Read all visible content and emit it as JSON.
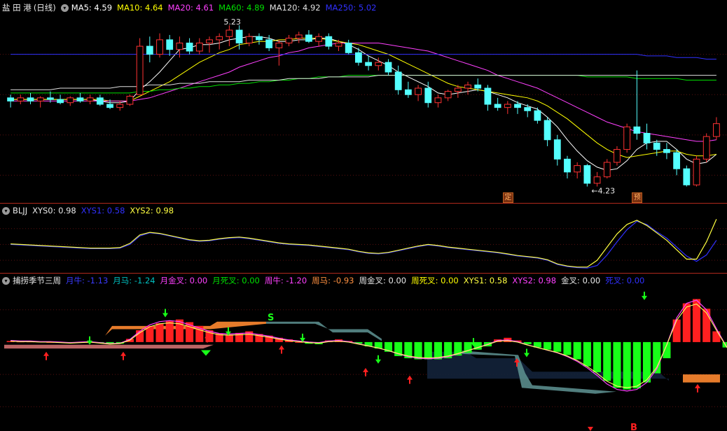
{
  "main": {
    "stock_name": "盐 田 港",
    "period": "(日线)",
    "ma": [
      {
        "label": "MA5",
        "value": "4.59",
        "color": "#ffffff"
      },
      {
        "label": "MA10",
        "value": "4.64",
        "color": "#ffff00"
      },
      {
        "label": "MA20",
        "value": "4.61",
        "color": "#ff40ff"
      },
      {
        "label": "MA60",
        "value": "4.89",
        "color": "#00e000"
      },
      {
        "label": "MA120",
        "value": "4.92",
        "color": "#e0e0e0"
      },
      {
        "label": "MA250",
        "value": "5.02",
        "color": "#3030ff"
      }
    ],
    "high_label": "5.23",
    "low_label": "4.23",
    "markers": [
      "定",
      "预"
    ],
    "colors": {
      "up": "#ff3232",
      "down": "#54ffff"
    }
  },
  "osc": {
    "name": "BLJJ",
    "items": [
      {
        "label": "XYS0",
        "value": "0.98",
        "color": "#e8e8e8"
      },
      {
        "label": "XYS1",
        "value": "0.58",
        "color": "#3030ff"
      },
      {
        "label": "XYS2",
        "value": "0.98",
        "color": "#ffff40"
      }
    ]
  },
  "ind": {
    "name": "捕捞季节三周",
    "items": [
      {
        "label": "月牛",
        "value": "-1.13",
        "color": "#3a3aff"
      },
      {
        "label": "月马",
        "value": "-1.24",
        "color": "#00c0c0"
      },
      {
        "label": "月金叉",
        "value": "0.00",
        "color": "#ff40ff"
      },
      {
        "label": "月死叉",
        "value": "0.00",
        "color": "#00e000"
      },
      {
        "label": "周牛",
        "value": "-1.20",
        "color": "#ff40ff"
      },
      {
        "label": "周马",
        "value": "-0.93",
        "color": "#ff9040"
      },
      {
        "label": "周金叉",
        "value": "0.00",
        "color": "#e8e8e8"
      },
      {
        "label": "周死叉",
        "value": "0.00",
        "color": "#ffff00"
      },
      {
        "label": "XYS1",
        "value": "0.58",
        "color": "#ffff40"
      },
      {
        "label": "XYS2",
        "value": "0.98",
        "color": "#ff40ff"
      },
      {
        "label": "金叉",
        "value": "0.00",
        "color": "#e8e8e8"
      },
      {
        "label": "死叉",
        "value": "0.00",
        "color": "#3030ff"
      }
    ],
    "s_label": "S",
    "b_label": "B"
  },
  "chart_data": {
    "type": "candlestick",
    "candles": [
      [
        4.78,
        4.8,
        4.72,
        4.76
      ],
      [
        4.76,
        4.8,
        4.74,
        4.78
      ],
      [
        4.78,
        4.81,
        4.74,
        4.76
      ],
      [
        4.76,
        4.79,
        4.72,
        4.78
      ],
      [
        4.78,
        4.82,
        4.75,
        4.77
      ],
      [
        4.77,
        4.8,
        4.74,
        4.75
      ],
      [
        4.75,
        4.79,
        4.73,
        4.78
      ],
      [
        4.78,
        4.81,
        4.75,
        4.76
      ],
      [
        4.76,
        4.8,
        4.74,
        4.78
      ],
      [
        4.78,
        4.8,
        4.73,
        4.74
      ],
      [
        4.74,
        4.77,
        4.71,
        4.72
      ],
      [
        4.72,
        4.76,
        4.7,
        4.74
      ],
      [
        4.74,
        4.8,
        4.73,
        4.79
      ],
      [
        4.8,
        5.15,
        4.8,
        5.1
      ],
      [
        5.1,
        5.16,
        5.0,
        5.05
      ],
      [
        5.05,
        5.18,
        5.03,
        5.14
      ],
      [
        5.14,
        5.17,
        5.04,
        5.08
      ],
      [
        5.08,
        5.16,
        5.03,
        5.12
      ],
      [
        5.12,
        5.15,
        5.05,
        5.07
      ],
      [
        5.07,
        5.15,
        5.05,
        5.12
      ],
      [
        5.12,
        5.16,
        5.06,
        5.14
      ],
      [
        5.14,
        5.18,
        5.08,
        5.16
      ],
      [
        5.16,
        5.23,
        5.1,
        5.2
      ],
      [
        5.2,
        5.23,
        5.08,
        5.12
      ],
      [
        5.12,
        5.18,
        5.1,
        5.16
      ],
      [
        5.16,
        5.18,
        5.11,
        5.14
      ],
      [
        5.14,
        5.17,
        5.07,
        5.09
      ],
      [
        5.09,
        5.14,
        4.98,
        5.12
      ],
      [
        5.12,
        5.17,
        5.1,
        5.15
      ],
      [
        5.15,
        5.19,
        5.12,
        5.17
      ],
      [
        5.17,
        5.2,
        5.12,
        5.13
      ],
      [
        5.13,
        5.18,
        5.1,
        5.16
      ],
      [
        5.16,
        5.18,
        5.08,
        5.1
      ],
      [
        5.1,
        5.14,
        5.07,
        5.12
      ],
      [
        5.12,
        5.14,
        5.05,
        5.06
      ],
      [
        5.06,
        5.09,
        4.98,
        5.0
      ],
      [
        5.0,
        5.04,
        4.95,
        4.98
      ],
      [
        4.98,
        5.03,
        4.95,
        5.0
      ],
      [
        5.0,
        5.02,
        4.92,
        4.94
      ],
      [
        4.94,
        4.98,
        4.8,
        4.83
      ],
      [
        4.83,
        4.88,
        4.78,
        4.8
      ],
      [
        4.8,
        4.86,
        4.76,
        4.84
      ],
      [
        4.84,
        4.88,
        4.72,
        4.75
      ],
      [
        4.75,
        4.8,
        4.72,
        4.78
      ],
      [
        4.78,
        4.83,
        4.76,
        4.82
      ],
      [
        4.82,
        4.86,
        4.78,
        4.84
      ],
      [
        4.84,
        4.88,
        4.8,
        4.86
      ],
      [
        4.86,
        4.9,
        4.82,
        4.84
      ],
      [
        4.84,
        4.86,
        4.7,
        4.74
      ],
      [
        4.74,
        4.78,
        4.7,
        4.72
      ],
      [
        4.72,
        4.76,
        4.68,
        4.74
      ],
      [
        4.74,
        4.76,
        4.68,
        4.72
      ],
      [
        4.72,
        4.74,
        4.66,
        4.7
      ],
      [
        4.7,
        4.72,
        4.62,
        4.64
      ],
      [
        4.64,
        4.66,
        4.48,
        4.52
      ],
      [
        4.52,
        4.55,
        4.36,
        4.4
      ],
      [
        4.4,
        4.42,
        4.28,
        4.32
      ],
      [
        4.32,
        4.38,
        4.28,
        4.36
      ],
      [
        4.36,
        4.37,
        4.23,
        4.25
      ],
      [
        4.25,
        4.32,
        4.23,
        4.29
      ],
      [
        4.29,
        4.4,
        4.28,
        4.38
      ],
      [
        4.38,
        4.48,
        4.36,
        4.46
      ],
      [
        4.46,
        4.62,
        4.44,
        4.6
      ],
      [
        4.6,
        4.95,
        4.52,
        4.56
      ],
      [
        4.56,
        4.62,
        4.46,
        4.5
      ],
      [
        4.5,
        4.52,
        4.42,
        4.46
      ],
      [
        4.46,
        4.5,
        4.4,
        4.44
      ],
      [
        4.44,
        4.46,
        4.3,
        4.34
      ],
      [
        4.34,
        4.36,
        4.23,
        4.24
      ],
      [
        4.24,
        4.42,
        4.23,
        4.4
      ],
      [
        4.4,
        4.56,
        4.38,
        4.54
      ],
      [
        4.54,
        4.66,
        4.52,
        4.62
      ]
    ],
    "ylim": [
      4.15,
      5.3
    ],
    "ma_series": {
      "MA5": [
        4.77,
        4.77,
        4.77,
        4.77,
        4.77,
        4.77,
        4.77,
        4.77,
        4.77,
        4.76,
        4.75,
        4.75,
        4.76,
        4.83,
        4.88,
        4.94,
        5.01,
        5.08,
        5.09,
        5.11,
        5.11,
        5.12,
        5.14,
        5.15,
        5.16,
        5.16,
        5.15,
        5.13,
        5.13,
        5.14,
        5.14,
        5.15,
        5.15,
        5.13,
        5.11,
        5.08,
        5.04,
        5.01,
        4.98,
        4.94,
        4.91,
        4.88,
        4.85,
        4.81,
        4.8,
        4.81,
        4.82,
        4.83,
        4.82,
        4.8,
        4.78,
        4.75,
        4.73,
        4.71,
        4.66,
        4.6,
        4.52,
        4.45,
        4.39,
        4.35,
        4.33,
        4.34,
        4.39,
        4.46,
        4.5,
        4.51,
        4.51,
        4.46,
        4.4,
        4.37,
        4.38,
        4.43
      ],
      "MA10": [
        4.77,
        4.77,
        4.77,
        4.77,
        4.77,
        4.77,
        4.77,
        4.77,
        4.77,
        4.77,
        4.76,
        4.76,
        4.76,
        4.79,
        4.82,
        4.85,
        4.88,
        4.92,
        4.96,
        5.0,
        5.03,
        5.06,
        5.08,
        5.11,
        5.12,
        5.13,
        5.13,
        5.14,
        5.14,
        5.15,
        5.15,
        5.15,
        5.14,
        5.13,
        5.12,
        5.11,
        5.09,
        5.07,
        5.05,
        5.02,
        4.99,
        4.96,
        4.93,
        4.9,
        4.87,
        4.85,
        4.84,
        4.83,
        4.82,
        4.81,
        4.8,
        4.79,
        4.78,
        4.76,
        4.73,
        4.69,
        4.65,
        4.6,
        4.55,
        4.5,
        4.46,
        4.43,
        4.41,
        4.42,
        4.43,
        4.44,
        4.45,
        4.45,
        4.43,
        4.42,
        4.42,
        4.43
      ],
      "MA20": [
        4.76,
        4.76,
        4.76,
        4.76,
        4.76,
        4.76,
        4.76,
        4.76,
        4.76,
        4.76,
        4.76,
        4.76,
        4.76,
        4.77,
        4.78,
        4.8,
        4.82,
        4.84,
        4.86,
        4.88,
        4.9,
        4.92,
        4.94,
        4.97,
        4.99,
        5.01,
        5.03,
        5.04,
        5.06,
        5.07,
        5.09,
        5.1,
        5.11,
        5.12,
        5.12,
        5.12,
        5.12,
        5.12,
        5.11,
        5.1,
        5.09,
        5.08,
        5.07,
        5.05,
        5.03,
        5.01,
        4.99,
        4.97,
        4.95,
        4.92,
        4.9,
        4.88,
        4.86,
        4.84,
        4.81,
        4.78,
        4.75,
        4.72,
        4.69,
        4.66,
        4.63,
        4.61,
        4.59,
        4.57,
        4.56,
        4.55,
        4.54,
        4.53,
        4.52,
        4.51,
        4.51,
        4.52
      ],
      "MA60": [
        4.81,
        4.81,
        4.81,
        4.81,
        4.81,
        4.81,
        4.81,
        4.81,
        4.81,
        4.81,
        4.81,
        4.81,
        4.81,
        4.82,
        4.82,
        4.83,
        4.83,
        4.84,
        4.84,
        4.85,
        4.85,
        4.86,
        4.86,
        4.87,
        4.87,
        4.88,
        4.88,
        4.89,
        4.89,
        4.9,
        4.9,
        4.91,
        4.91,
        4.91,
        4.92,
        4.92,
        4.92,
        4.92,
        4.92,
        4.92,
        4.92,
        4.92,
        4.92,
        4.92,
        4.92,
        4.92,
        4.92,
        4.92,
        4.92,
        4.92,
        4.92,
        4.92,
        4.92,
        4.92,
        4.92,
        4.92,
        4.92,
        4.92,
        4.91,
        4.91,
        4.91,
        4.91,
        4.91,
        4.9,
        4.9,
        4.9,
        4.9,
        4.9,
        4.89,
        4.89,
        4.89,
        4.89
      ],
      "MA120": [
        4.83,
        4.83,
        4.83,
        4.83,
        4.83,
        4.84,
        4.84,
        4.84,
        4.84,
        4.84,
        4.84,
        4.85,
        4.85,
        4.85,
        4.86,
        4.86,
        4.86,
        4.87,
        4.87,
        4.87,
        4.88,
        4.88,
        4.88,
        4.88,
        4.89,
        4.89,
        4.89,
        4.89,
        4.9,
        4.9,
        4.9,
        4.9,
        4.91,
        4.91,
        4.91,
        4.91,
        4.91,
        4.92,
        4.92,
        4.92,
        4.92,
        4.92,
        4.92,
        4.92,
        4.92,
        4.92,
        4.92,
        4.92,
        4.92,
        4.92,
        4.92,
        4.92,
        4.92,
        4.92,
        4.92,
        4.92,
        4.92,
        4.92,
        4.92,
        4.92,
        4.92,
        4.92,
        4.92,
        4.92,
        4.92,
        4.92,
        4.92,
        4.92,
        4.92,
        4.92,
        4.92,
        4.92
      ],
      "MA250": [
        5.05,
        5.05,
        5.05,
        5.05,
        5.05,
        5.05,
        5.05,
        5.05,
        5.05,
        5.05,
        5.05,
        5.05,
        5.05,
        5.05,
        5.05,
        5.05,
        5.05,
        5.05,
        5.05,
        5.05,
        5.05,
        5.05,
        5.05,
        5.05,
        5.05,
        5.05,
        5.05,
        5.05,
        5.05,
        5.05,
        5.05,
        5.05,
        5.05,
        5.05,
        5.05,
        5.05,
        5.05,
        5.05,
        5.05,
        5.05,
        5.05,
        5.05,
        5.05,
        5.05,
        5.05,
        5.05,
        5.05,
        5.05,
        5.05,
        5.05,
        5.05,
        5.05,
        5.05,
        5.05,
        5.05,
        5.05,
        5.05,
        5.05,
        5.05,
        5.05,
        5.05,
        5.05,
        5.05,
        5.05,
        5.04,
        5.04,
        5.04,
        5.03,
        5.03,
        5.03,
        5.02,
        5.02
      ]
    },
    "osc": {
      "ylim": [
        0,
        1.05
      ],
      "XYS1": [
        0.5,
        0.49,
        0.48,
        0.47,
        0.46,
        0.45,
        0.44,
        0.43,
        0.42,
        0.42,
        0.42,
        0.43,
        0.5,
        0.66,
        0.72,
        0.7,
        0.66,
        0.62,
        0.58,
        0.56,
        0.57,
        0.6,
        0.62,
        0.63,
        0.61,
        0.58,
        0.55,
        0.52,
        0.5,
        0.49,
        0.48,
        0.46,
        0.44,
        0.42,
        0.4,
        0.36,
        0.33,
        0.32,
        0.34,
        0.38,
        0.42,
        0.46,
        0.49,
        0.47,
        0.44,
        0.42,
        0.4,
        0.38,
        0.36,
        0.34,
        0.31,
        0.28,
        0.26,
        0.24,
        0.2,
        0.12,
        0.08,
        0.06,
        0.05,
        0.1,
        0.3,
        0.55,
        0.78,
        0.94,
        0.88,
        0.74,
        0.62,
        0.45,
        0.28,
        0.18,
        0.3,
        0.58
      ],
      "XYS2": [
        0.51,
        0.5,
        0.49,
        0.48,
        0.47,
        0.46,
        0.45,
        0.44,
        0.43,
        0.43,
        0.43,
        0.44,
        0.52,
        0.68,
        0.73,
        0.71,
        0.67,
        0.63,
        0.59,
        0.57,
        0.58,
        0.61,
        0.63,
        0.64,
        0.62,
        0.59,
        0.56,
        0.53,
        0.51,
        0.5,
        0.49,
        0.47,
        0.45,
        0.43,
        0.41,
        0.37,
        0.34,
        0.33,
        0.35,
        0.39,
        0.43,
        0.47,
        0.5,
        0.48,
        0.45,
        0.43,
        0.41,
        0.39,
        0.37,
        0.35,
        0.32,
        0.29,
        0.27,
        0.25,
        0.21,
        0.13,
        0.09,
        0.07,
        0.07,
        0.2,
        0.45,
        0.7,
        0.88,
        0.96,
        0.86,
        0.72,
        0.58,
        0.4,
        0.22,
        0.22,
        0.55,
        0.98
      ]
    },
    "ind": {
      "ylim": [
        -1.6,
        1.0
      ],
      "bars": [
        0.02,
        0.01,
        0.01,
        0.01,
        0.0,
        -0.01,
        -0.02,
        -0.01,
        0.0,
        -0.02,
        -0.04,
        -0.03,
        0.06,
        0.22,
        0.3,
        0.35,
        0.4,
        0.42,
        0.37,
        0.3,
        0.22,
        0.16,
        0.14,
        0.17,
        0.2,
        0.15,
        0.12,
        0.08,
        0.05,
        0.0,
        -0.03,
        -0.04,
        0.03,
        0.05,
        0.02,
        -0.03,
        -0.08,
        -0.12,
        -0.18,
        -0.26,
        -0.3,
        -0.32,
        -0.32,
        -0.32,
        -0.3,
        -0.25,
        -0.2,
        -0.14,
        -0.08,
        0.05,
        0.08,
        0.03,
        -0.04,
        -0.1,
        -0.14,
        -0.18,
        -0.24,
        -0.32,
        -0.45,
        -0.56,
        -0.72,
        -0.85,
        -0.88,
        -0.86,
        -0.75,
        -0.58,
        -0.3,
        0.42,
        0.72,
        0.8,
        0.62,
        0.2,
        -0.1,
        -0.32,
        -0.44,
        -0.1,
        0.1,
        0.52
      ],
      "line_y": [
        0.03,
        0.02,
        0.02,
        0.01,
        0.01,
        0.0,
        -0.01,
        0.0,
        0.01,
        -0.01,
        -0.03,
        -0.02,
        0.05,
        0.2,
        0.32,
        0.38,
        0.4,
        0.38,
        0.32,
        0.26,
        0.2,
        0.16,
        0.15,
        0.16,
        0.17,
        0.14,
        0.11,
        0.07,
        0.04,
        0.02,
        0.0,
        -0.01,
        0.02,
        0.03,
        0.01,
        -0.03,
        -0.07,
        -0.11,
        -0.16,
        -0.22,
        -0.27,
        -0.3,
        -0.31,
        -0.3,
        -0.27,
        -0.22,
        -0.16,
        -0.1,
        -0.04,
        0.03,
        0.04,
        0.01,
        -0.05,
        -0.1,
        -0.15,
        -0.2,
        -0.27,
        -0.36,
        -0.48,
        -0.62,
        -0.78,
        -0.88,
        -0.91,
        -0.88,
        -0.75,
        -0.5,
        -0.05,
        0.45,
        0.72,
        0.78,
        0.6,
        0.25,
        -0.08,
        -0.34,
        -0.42,
        -0.18,
        0.15,
        0.46
      ]
    }
  }
}
